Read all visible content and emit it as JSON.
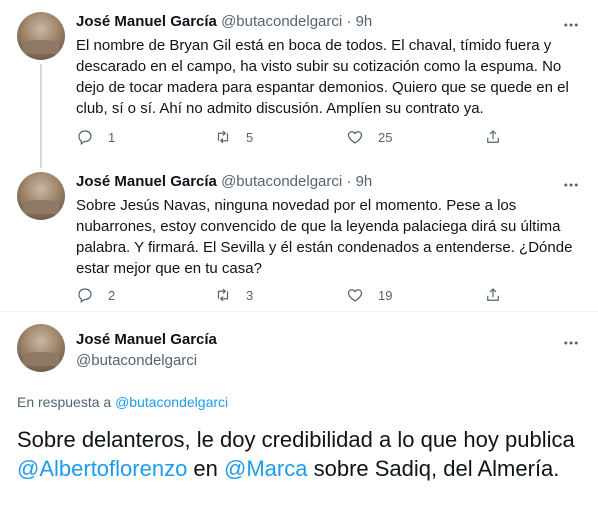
{
  "tweets": [
    {
      "name": "José Manuel García",
      "handle": "@butacondelgarci",
      "dot": "·",
      "time": "9h",
      "text": "El nombre de Bryan Gil está en boca de todos. El chaval, tímido fuera y descarado en el campo, ha visto subir su cotización como la espuma. No dejo de tocar madera para espantar demonios. Quiero que se quede en el club, sí o sí. Ahí no admito discusión. Amplíen su contrato ya.",
      "replies": "1",
      "retweets": "5",
      "likes": "25"
    },
    {
      "name": "José Manuel García",
      "handle": "@butacondelgarci",
      "dot": "·",
      "time": "9h",
      "text": "Sobre Jesús Navas, ninguna novedad por el momento. Pese a los nubarrones, estoy convencido de que la leyenda palaciega dirá su última palabra. Y firmará. El Sevilla y él están condenados a entenderse. ¿Dónde estar mejor que en tu casa?",
      "replies": "2",
      "retweets": "3",
      "likes": "19"
    }
  ],
  "main_tweet": {
    "name": "José Manuel García",
    "handle": "@butacondelgarci",
    "reply_prefix": "En respuesta a",
    "reply_handle": "@butacondelgarci",
    "text_part1": "Sobre delanteros, le doy credibilidad a lo que hoy publica ",
    "mention1": "@Albertoflorenzo",
    "text_part2": " en ",
    "mention2": "@Marca",
    "text_part3": " sobre Sadiq, del Almería."
  },
  "icons": {
    "reply": "reply-icon",
    "retweet": "retweet-icon",
    "like": "heart-icon",
    "share": "share-icon",
    "more": "more-icon"
  },
  "colors": {
    "text": "#0f1419",
    "secondary": "#536471",
    "link": "#1d9bf0",
    "thread_line": "#cfd9de"
  }
}
